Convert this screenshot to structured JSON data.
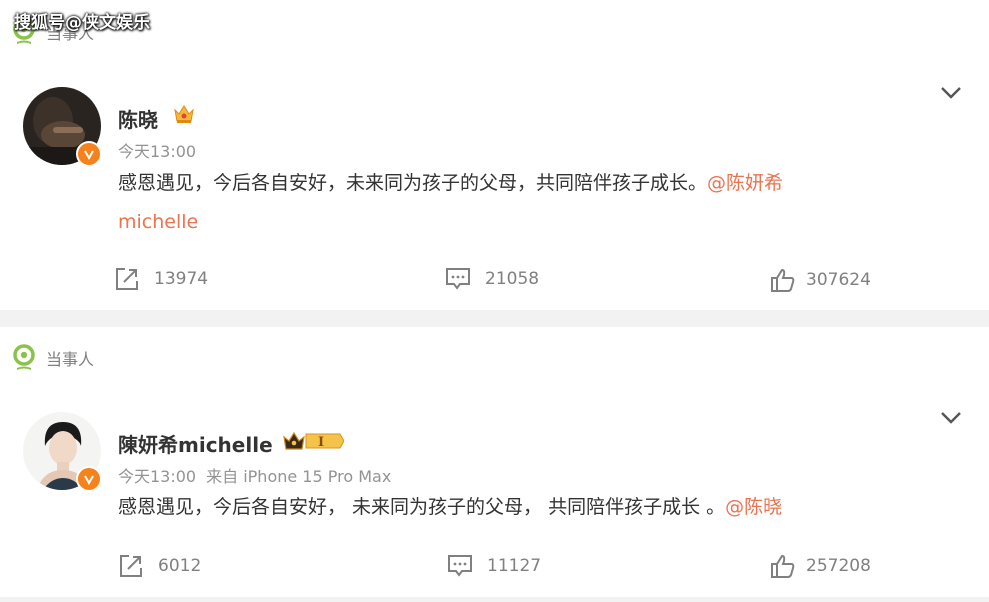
{
  "watermark": "搜狐号@侠文娱乐",
  "posts": [
    {
      "tag_label": "当事人",
      "author": "陈晓",
      "time": "今天13:00",
      "source": "",
      "content_text": "感恩遇见，今后各自安好，未来同为孩子的父母，共同陪伴孩子成长。",
      "mention_line1": "@陈妍希",
      "mention_line2": "michelle",
      "repost_count": "13974",
      "comment_count": "21058",
      "like_count": "307624"
    },
    {
      "tag_label": "当事人",
      "author": "陳妍希michelle",
      "time": "今天13:00",
      "source": "来自 iPhone 15 Pro Max",
      "content_text": "感恩遇见，今后各自安好， 未来同为孩子的父母， 共同陪伴孩子成长 。",
      "mention": "@陈晓",
      "repost_count": "6012",
      "comment_count": "11127",
      "like_count": "257208"
    }
  ],
  "colors": {
    "mention": "#eb7350",
    "verify_badge": "#f7811a",
    "tag_icon": "#8bc34a"
  },
  "icons": [
    "location-tag-icon",
    "crown-icon",
    "vip-crown-icon",
    "chevron-down-icon",
    "repost-icon",
    "comment-icon",
    "like-icon",
    "verified-icon"
  ]
}
